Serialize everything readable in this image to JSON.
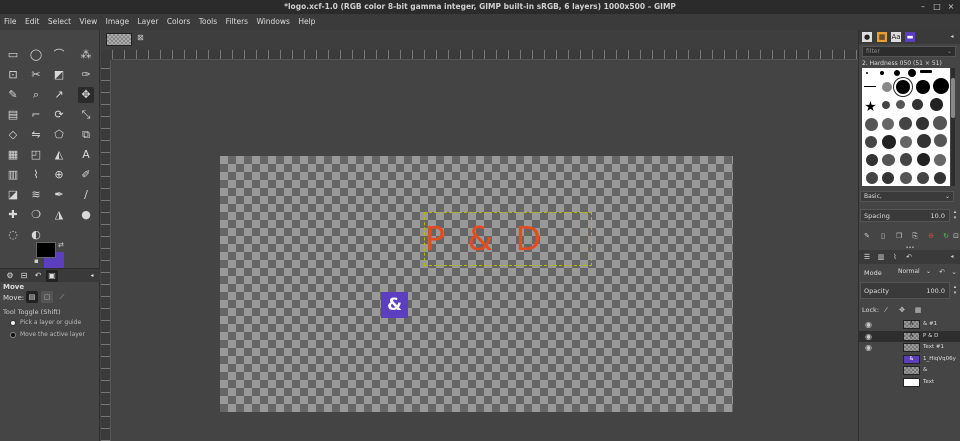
{
  "window": {
    "title": "*logo.xcf-1.0 (RGB color 8-bit gamma integer, GIMP built-in sRGB, 6 layers) 1000x500 – GIMP",
    "minimize": "–",
    "maximize": "□",
    "close": "×"
  },
  "menu": [
    "File",
    "Edit",
    "Select",
    "View",
    "Image",
    "Layer",
    "Colors",
    "Tools",
    "Filters",
    "Windows",
    "Help"
  ],
  "toolbox": {
    "tools": [
      {
        "name": "rect-select-icon",
        "glyph": "▭"
      },
      {
        "name": "ellipse-select-icon",
        "glyph": "◯"
      },
      {
        "name": "free-select-icon",
        "glyph": "⌒"
      },
      {
        "name": "fuzzy-select-icon",
        "glyph": "⁂"
      },
      {
        "name": "crop-icon",
        "glyph": "⊡"
      },
      {
        "name": "scissors-icon",
        "glyph": "✂"
      },
      {
        "name": "foreground-select-icon",
        "glyph": "◩"
      },
      {
        "name": "paths-icon",
        "glyph": "✑"
      },
      {
        "name": "color-picker-icon",
        "glyph": "✎"
      },
      {
        "name": "zoom-icon",
        "glyph": "⌕"
      },
      {
        "name": "measure-icon",
        "glyph": "↗"
      },
      {
        "name": "move-icon",
        "glyph": "✥"
      },
      {
        "name": "align-icon",
        "glyph": "▤"
      },
      {
        "name": "crop-tool-icon",
        "glyph": "⌐"
      },
      {
        "name": "unified-transform-icon",
        "glyph": "⟳"
      },
      {
        "name": "warp-transform-icon",
        "glyph": "⤡"
      },
      {
        "name": "perspective-icon",
        "glyph": "◇"
      },
      {
        "name": "flip-icon",
        "glyph": "⇋"
      },
      {
        "name": "cage-transform-icon",
        "glyph": "⬠"
      },
      {
        "name": "handle-transform-icon",
        "glyph": "⧉"
      },
      {
        "name": "seamless-clone-icon",
        "glyph": "▦"
      },
      {
        "name": "transform-3d-icon",
        "glyph": "◰"
      },
      {
        "name": "bucket-fill-icon",
        "glyph": "◭"
      },
      {
        "name": "text-icon",
        "glyph": "A"
      },
      {
        "name": "gradient-icon",
        "glyph": "▥"
      },
      {
        "name": "paintbrush-icon",
        "glyph": "⌇"
      },
      {
        "name": "clone-icon",
        "glyph": "⊕"
      },
      {
        "name": "smudge-icon",
        "glyph": "✐"
      },
      {
        "name": "eraser-icon",
        "glyph": "◪"
      },
      {
        "name": "airbrush-icon",
        "glyph": "≋"
      },
      {
        "name": "ink-icon",
        "glyph": "✒"
      },
      {
        "name": "mypaint-brush-icon",
        "glyph": "∕"
      },
      {
        "name": "heal-icon",
        "glyph": "✚"
      },
      {
        "name": "blur-icon",
        "glyph": "❍"
      },
      {
        "name": "dodge-burn-icon",
        "glyph": "◮"
      },
      {
        "name": "drop-icon",
        "glyph": "●"
      },
      {
        "name": "warp-icon",
        "glyph": "◌"
      },
      {
        "name": "color-tool-icon",
        "glyph": "◐"
      }
    ],
    "options_title": "Move",
    "move_label": "Move:",
    "toggle_label": "Tool Toggle  (Shift)",
    "radio1": "Pick a layer or guide",
    "radio2": "Move the active layer"
  },
  "canvas": {
    "pd_text": "P & D",
    "amp_text": "&"
  },
  "colors": {
    "foreground": "#000000",
    "background": "#5b3fbf",
    "pd_text_color": "#e24c1f",
    "selection_outline": "#b8b800"
  },
  "brushes": {
    "filter_placeholder": "filter",
    "brush_title": "2. Hardness 050 (51 × 51)",
    "preset": "Basic,",
    "spacing_label": "Spacing",
    "spacing_value": "10.0"
  },
  "layers": {
    "mode_label": "Mode",
    "mode_value": "Normal",
    "opacity_label": "Opacity",
    "opacity_value": "100.0",
    "lock_label": "Lock:",
    "items": [
      {
        "name": "& #1",
        "visible": true,
        "thumb": "text"
      },
      {
        "name": "P & D",
        "visible": true,
        "thumb": "text"
      },
      {
        "name": "Text #1",
        "visible": true,
        "thumb": "checker"
      },
      {
        "name": "1_HiqVq06y",
        "visible": false,
        "thumb": "purple"
      },
      {
        "name": "&",
        "visible": false,
        "thumb": "checker"
      },
      {
        "name": "Text",
        "visible": false,
        "thumb": "white"
      }
    ]
  }
}
